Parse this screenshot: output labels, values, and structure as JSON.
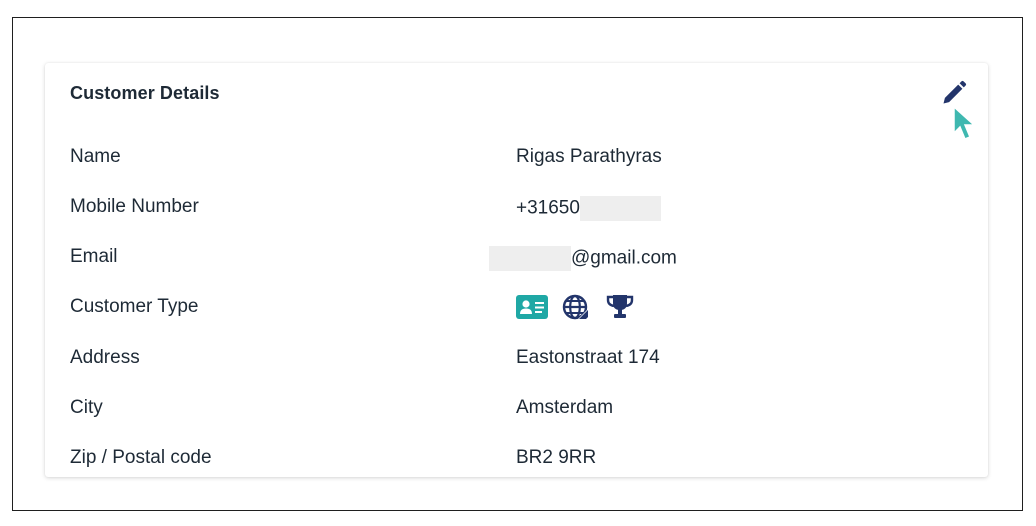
{
  "card": {
    "title": "Customer Details",
    "edit_icon": "pencil-icon"
  },
  "fields": [
    {
      "label": "Name",
      "value": "Rigas Parathyras"
    },
    {
      "label": "Mobile Number",
      "value": "+31650"
    },
    {
      "label": "Email",
      "value": "@gmail.com"
    },
    {
      "label": "Customer Type",
      "icons": [
        "id-card-icon",
        "global-icon",
        "trophy-icon"
      ]
    },
    {
      "label": "Address",
      "value": "Eastonstraat 174"
    },
    {
      "label": "City",
      "value": "Amsterdam"
    },
    {
      "label": "Zip / Postal code",
      "value": "BR2 9RR"
    }
  ],
  "colors": {
    "text": "#1e2a36",
    "icon_navy": "#23356b",
    "icon_teal": "#1fa8a5",
    "cursor_teal": "#3fb8b0",
    "redaction": "#eeeeee"
  }
}
